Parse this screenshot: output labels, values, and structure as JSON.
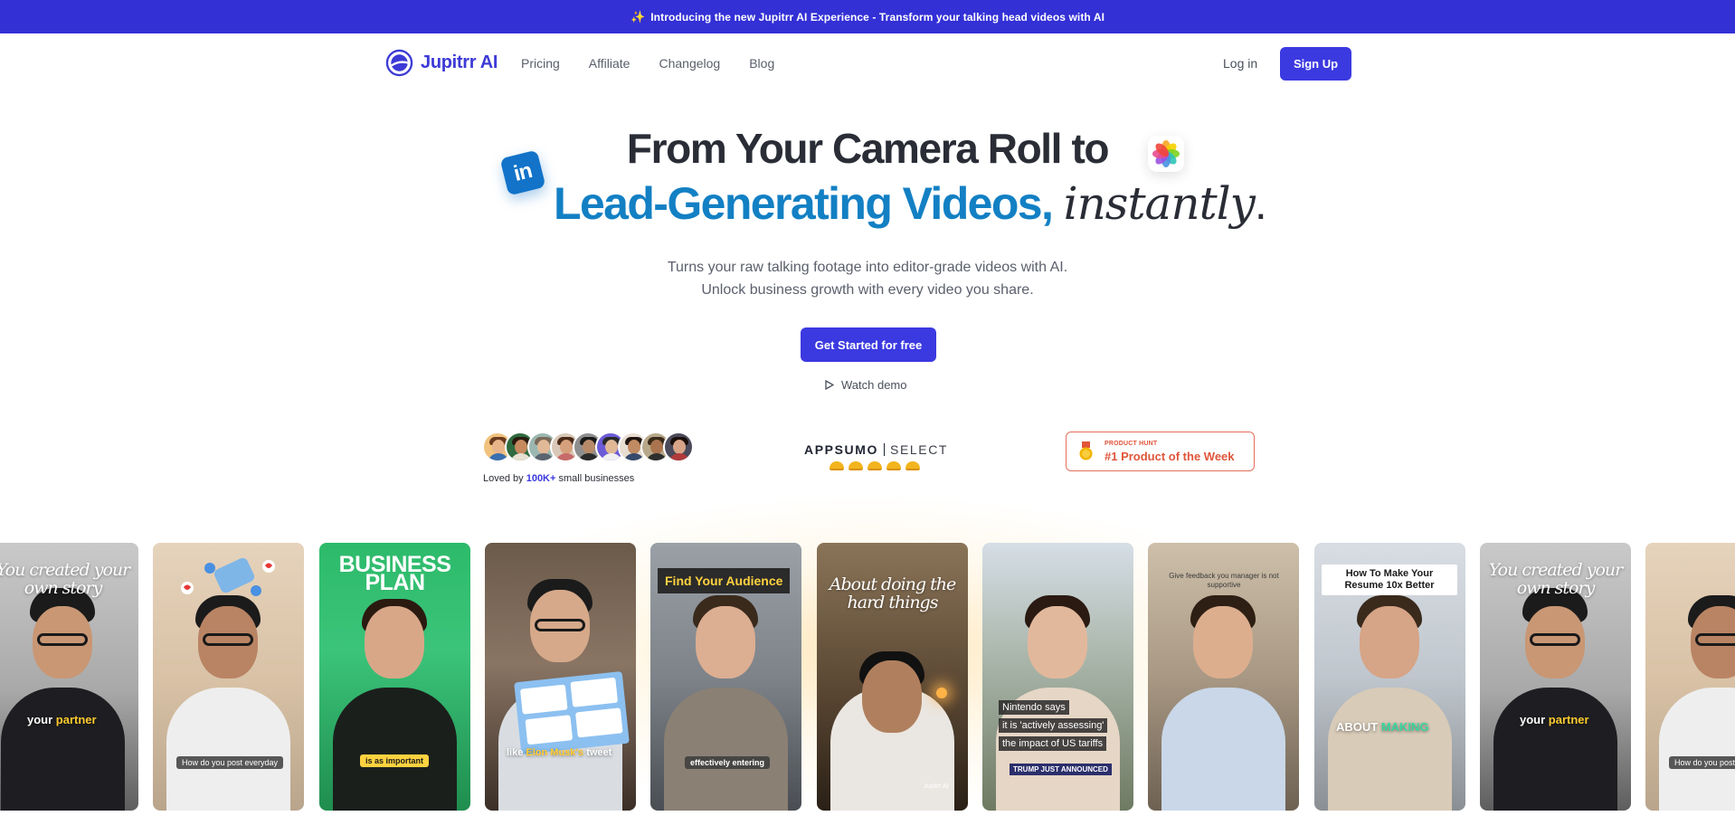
{
  "banner": {
    "spark_icon": "sparkles-icon",
    "text": "Introducing the new Jupitrr AI Experience - Transform your talking head videos with AI"
  },
  "nav": {
    "logo_text": "Jupitrr AI",
    "links": [
      "Pricing",
      "Affiliate",
      "Changelog",
      "Blog"
    ],
    "login": "Log in",
    "signup": "Sign Up"
  },
  "hero": {
    "line1_pre": "From Your ",
    "line1_bold": "Camera Roll",
    "line1_post": " to",
    "line2_blue": "Lead-Generating Videos,",
    "line2_italic": "instantly",
    "line2_dot": ".",
    "linkedin_label": "in",
    "sub1": "Turns your raw talking footage into editor-grade videos with AI.",
    "sub2": "Unlock business growth with every video you share.",
    "cta": "Get Started for free",
    "demo": "Watch demo"
  },
  "social": {
    "loved_pre": "Loved by ",
    "loved_count": "100K+",
    "loved_post": " small businesses",
    "appsumo_word": "APPSUMO",
    "appsumo_select": "SELECT",
    "ph_small": "PRODUCT HUNT",
    "ph_big": "#1 Product of the Week"
  },
  "colors": {
    "brand": "#3b39e0",
    "banner": "#3330d6",
    "headline_blue": "#1380c4",
    "producthunt": "#e0553a"
  },
  "cards": [
    {
      "caption_top": "You created your own story",
      "caption_bottom_a": "your ",
      "caption_bottom_b": "partner"
    },
    {
      "caption_pill": "How do you post everyday"
    },
    {
      "caption_top": "BUSINESS PLAN",
      "caption_pill": "is as important"
    },
    {
      "caption_bottom_a": "like ",
      "caption_bottom_b": "Elon Musk's",
      "caption_bottom_c": " tweet"
    },
    {
      "caption_top": "Find Your Audience",
      "caption_pill": "effectively entering"
    },
    {
      "caption_top": "About doing the hard things",
      "watermark": "Jupitrr AI"
    },
    {
      "caption_a": "Nintendo says",
      "caption_b": "it is 'actively assessing'",
      "caption_c": "the impact of US tariffs",
      "caption_d": "TRUMP JUST ANNOUNCED"
    },
    {
      "caption_top": "Give feedback you manager is not supportive"
    },
    {
      "caption_top": "How To Make Your Resume 10x Better",
      "caption_bottom_a": "ABOUT ",
      "caption_bottom_b": "MAKING"
    },
    {
      "caption_top": "You created your own story",
      "caption_bottom_a": "your ",
      "caption_bottom_b": "partner"
    },
    {
      "caption_pill": "How do you post"
    }
  ]
}
